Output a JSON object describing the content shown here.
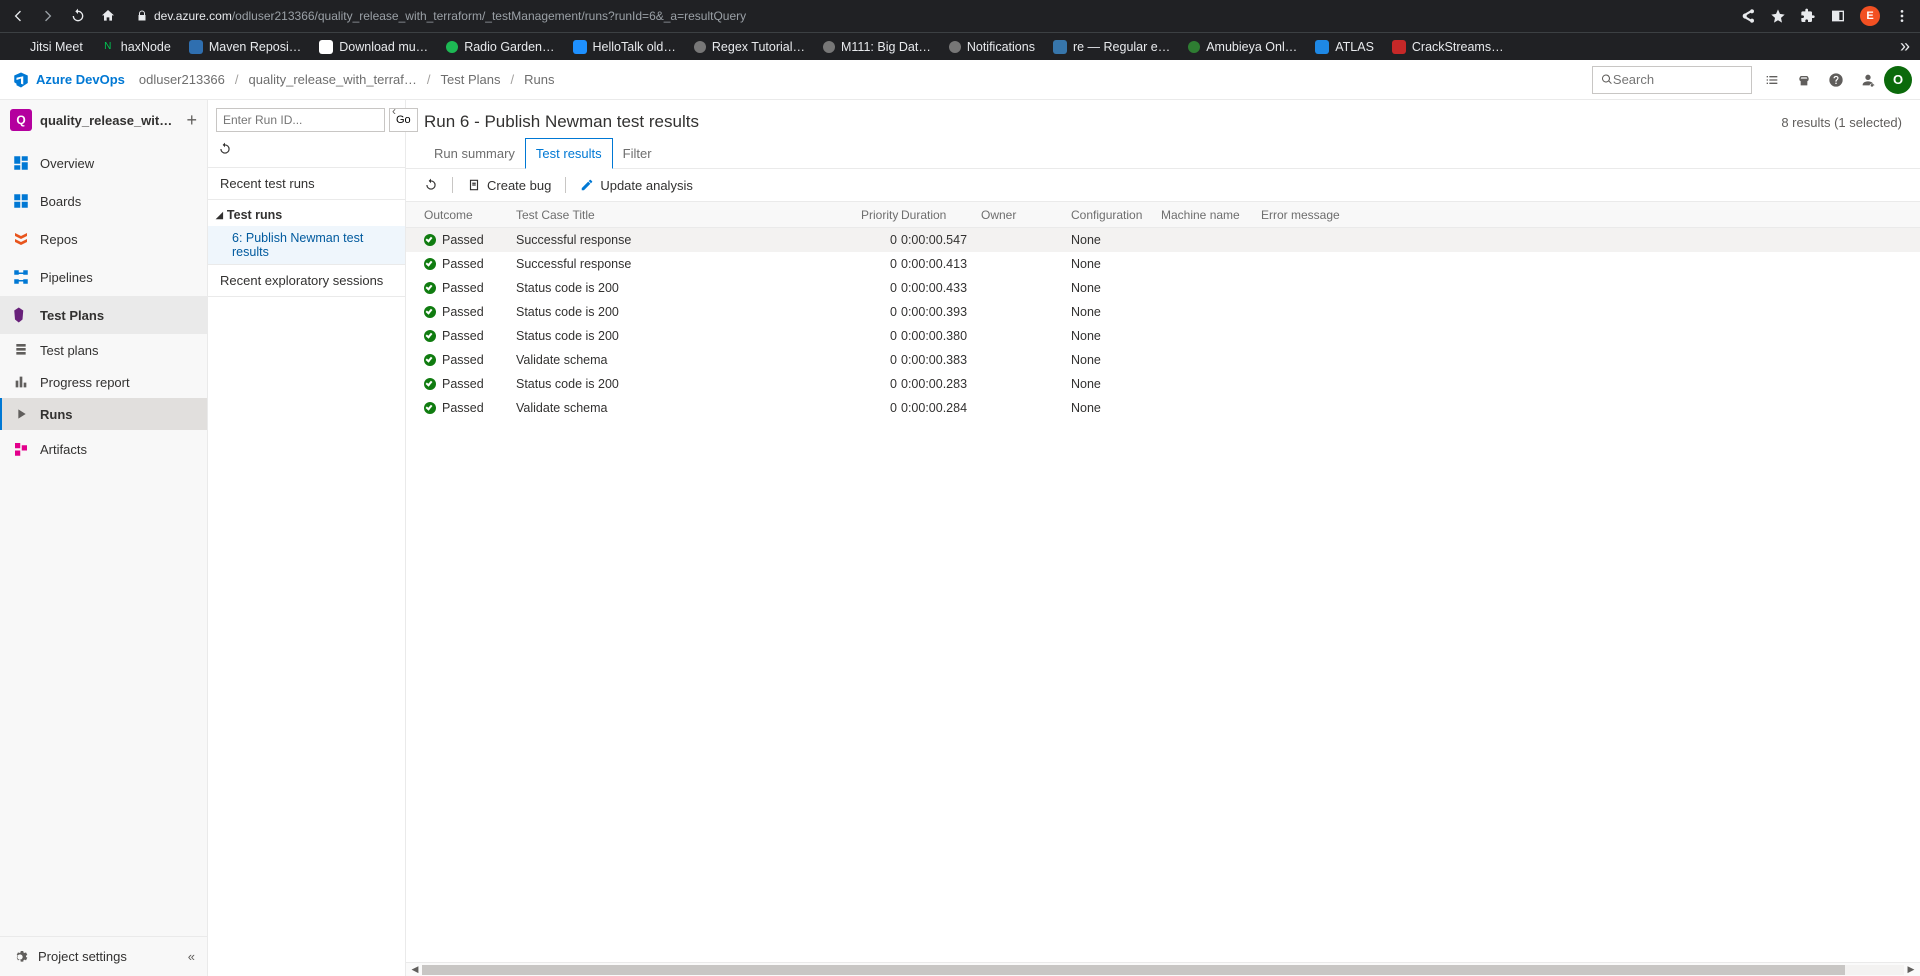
{
  "browser": {
    "url_domain": "dev.azure.com",
    "url_path": "/odluser213366/quality_release_with_terraform/_testManagement/runs?runId=6&_a=resultQuery",
    "avatar_letter": "E",
    "bookmarks": [
      {
        "label": "Jitsi Meet",
        "color": "#202124",
        "shape": "dot"
      },
      {
        "label": "haxNode",
        "color": "#0aa34a",
        "shape": "sq",
        "prefix": "N"
      },
      {
        "label": "Maven Reposi…",
        "color": "#2f6fb0",
        "shape": "sq"
      },
      {
        "label": "Download mu…",
        "color": "#ffffff",
        "shape": "sq"
      },
      {
        "label": "Radio Garden…",
        "color": "#1db954",
        "shape": "circ"
      },
      {
        "label": "HelloTalk old…",
        "color": "#1e90ff",
        "shape": "sq"
      },
      {
        "label": "Regex Tutorial…",
        "color": "#777",
        "shape": "circ"
      },
      {
        "label": "M111: Big Dat…",
        "color": "#777",
        "shape": "circ"
      },
      {
        "label": "Notifications",
        "color": "#777",
        "shape": "circ"
      },
      {
        "label": "re — Regular e…",
        "color": "#3776ab",
        "shape": "sq"
      },
      {
        "label": "Amubieya Onl…",
        "color": "#2e7d32",
        "shape": "circ"
      },
      {
        "label": "ATLAS",
        "color": "#1e88e5",
        "shape": "sq"
      },
      {
        "label": "CrackStreams…",
        "color": "#c62828",
        "shape": "sq"
      }
    ]
  },
  "header": {
    "product": "Azure DevOps",
    "crumbs": [
      "odluser213366",
      "quality_release_with_terraf…",
      "Test Plans",
      "Runs"
    ],
    "search_placeholder": "Search",
    "user_letter": "O"
  },
  "leftnav": {
    "project_short": "Q",
    "project_name": "quality_release_with_t…",
    "items": [
      {
        "label": "Overview",
        "color": "#0078d4"
      },
      {
        "label": "Boards",
        "color": "#0078d4"
      },
      {
        "label": "Repos",
        "color": "#e8551d"
      },
      {
        "label": "Pipelines",
        "color": "#0078d4"
      },
      {
        "label": "Test Plans",
        "color": "#68217a",
        "group": true
      }
    ],
    "subitems": [
      {
        "label": "Test plans"
      },
      {
        "label": "Progress report"
      },
      {
        "label": "Runs",
        "selected": true
      }
    ],
    "trailing": {
      "label": "Artifacts",
      "color": "#e3008c"
    },
    "footer": "Project settings"
  },
  "runs_panel": {
    "input_placeholder": "Enter Run ID...",
    "go": "Go",
    "recent_runs": "Recent test runs",
    "tree_label": "Test runs",
    "tree_item": "6: Publish Newman test results",
    "exploratory": "Recent exploratory sessions"
  },
  "page": {
    "title": "Run 6 - Publish Newman test results",
    "results_count": "8 results (1 selected)",
    "tabs": {
      "summary": "Run summary",
      "results": "Test results",
      "filter": "Filter"
    },
    "toolbar": {
      "create_bug": "Create bug",
      "update_analysis": "Update analysis"
    }
  },
  "table": {
    "columns": {
      "outcome": "Outcome",
      "title": "Test Case Title",
      "priority": "Priority",
      "duration": "Duration",
      "owner": "Owner",
      "configuration": "Configuration",
      "machine": "Machine name",
      "error": "Error message"
    },
    "rows": [
      {
        "outcome": "Passed",
        "title": "Successful response",
        "priority": "0",
        "duration": "0:00:00.547",
        "configuration": "None",
        "selected": true
      },
      {
        "outcome": "Passed",
        "title": "Successful response",
        "priority": "0",
        "duration": "0:00:00.413",
        "configuration": "None"
      },
      {
        "outcome": "Passed",
        "title": "Status code is 200",
        "priority": "0",
        "duration": "0:00:00.433",
        "configuration": "None"
      },
      {
        "outcome": "Passed",
        "title": "Status code is 200",
        "priority": "0",
        "duration": "0:00:00.393",
        "configuration": "None"
      },
      {
        "outcome": "Passed",
        "title": "Status code is 200",
        "priority": "0",
        "duration": "0:00:00.380",
        "configuration": "None"
      },
      {
        "outcome": "Passed",
        "title": "Validate schema",
        "priority": "0",
        "duration": "0:00:00.383",
        "configuration": "None"
      },
      {
        "outcome": "Passed",
        "title": "Status code is 200",
        "priority": "0",
        "duration": "0:00:00.283",
        "configuration": "None"
      },
      {
        "outcome": "Passed",
        "title": "Validate schema",
        "priority": "0",
        "duration": "0:00:00.284",
        "configuration": "None"
      }
    ]
  }
}
